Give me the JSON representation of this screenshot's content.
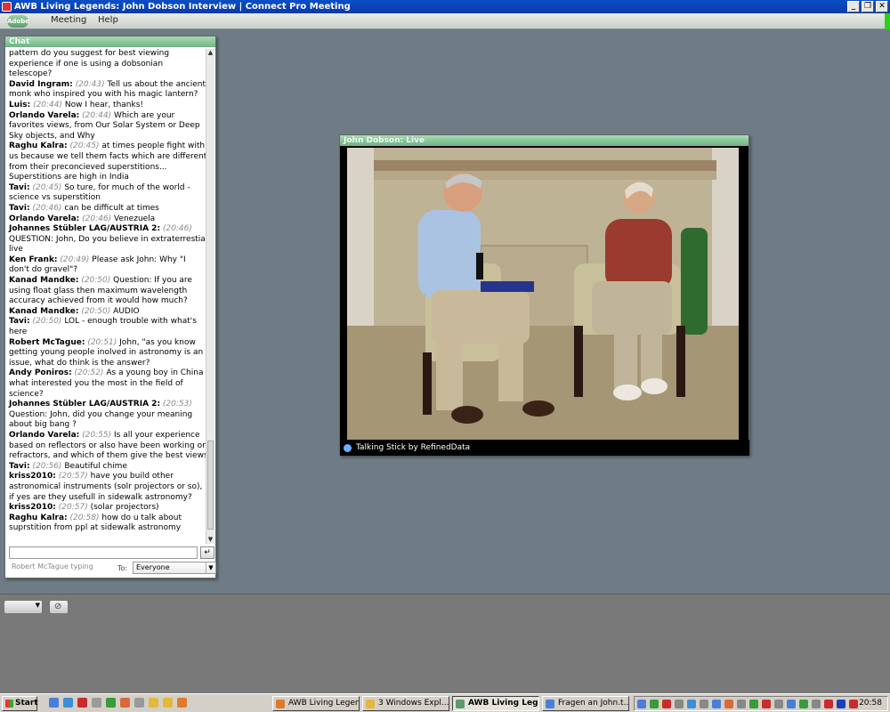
{
  "window": {
    "title": "AWB Living Legends: John Dobson Interview | Connect Pro Meeting",
    "min_glyph": "_",
    "max_glyph": "❐",
    "close_glyph": "✕"
  },
  "menubar": {
    "logo_text": "Adobe",
    "items": [
      "Meeting",
      "Help"
    ]
  },
  "chat": {
    "title": "Chat",
    "messages": [
      {
        "name": "",
        "time": "",
        "text": "pattern do you suggest for best viewing experience if one is using a dobsonian telescope?"
      },
      {
        "name": "David Ingram:",
        "time": "(20:43)",
        "text": "Tell us about the ancient monk who inspired you with his magic lantern?"
      },
      {
        "name": "Luis:",
        "time": "(20:44)",
        "text": "Now I hear, thanks!"
      },
      {
        "name": "Orlando Varela:",
        "time": "(20:44)",
        "text": "Which are your favorites views, from Our Solar System or Deep Sky objects, and Why"
      },
      {
        "name": "Raghu Kalra:",
        "time": "(20:45)",
        "text": "at times people fight with us because we tell them facts which are different from their preconcieved superstitions... Superstitions are high in India"
      },
      {
        "name": "Tavi:",
        "time": "(20:45)",
        "text": "So ture, for much of the world - science vs superstition"
      },
      {
        "name": "Tavi:",
        "time": "(20:46)",
        "text": "can be difficult at times"
      },
      {
        "name": "Orlando Varela:",
        "time": "(20:46)",
        "text": "Venezuela"
      },
      {
        "name": "Johannes Stübler LAG/AUSTRIA 2:",
        "time": "(20:46)",
        "text": "QUESTION: John, Do you believe in extraterrestial live"
      },
      {
        "name": "Ken Frank:",
        "time": "(20:49)",
        "text": "Please ask John: Why \"I don't do gravel\"?"
      },
      {
        "name": "Kanad Mandke:",
        "time": "(20:50)",
        "text": "Question: If you are using float glass then maximum wavelength accuracy achieved from it would how much?"
      },
      {
        "name": "Kanad Mandke:",
        "time": "(20:50)",
        "text": "AUDIO"
      },
      {
        "name": "Tavi:",
        "time": "(20:50)",
        "text": "LOL - enough trouble with what's here"
      },
      {
        "name": "Robert McTague:",
        "time": "(20:51)",
        "text": "John, \"as you know getting young people inolved in astronomy is an issue,  what do think is the answer?"
      },
      {
        "name": "Andy Poniros:",
        "time": "(20:52)",
        "text": "As a young boy in China what interested you the most in the field of science?"
      },
      {
        "name": "Johannes Stübler LAG/AUSTRIA 2:",
        "time": "(20:53)",
        "text": "Question: John, did you change your meaning about big bang ?"
      },
      {
        "name": "Orlando Varela:",
        "time": "(20:55)",
        "text": "Is all your experience based on reflectors or  also have been working on refractors, and which of them give the best views"
      },
      {
        "name": "Tavi:",
        "time": "(20:56)",
        "text": "Beautiful chime"
      },
      {
        "name": "kriss2010:",
        "time": "(20:57)",
        "text": "have you build other astronomical instruments (solr projectors or so), if yes are they usefull in sidewalk astronomy?"
      },
      {
        "name": "kriss2010:",
        "time": "(20:57)",
        "text": "(solar projectors)"
      },
      {
        "name": "Raghu Kalra:",
        "time": "(20:58)",
        "text": "how do u talk about suprstition from ppl at sidewalk astronomy"
      }
    ],
    "input_value": "",
    "send_glyph": "↵",
    "typing_status": "Robert McTague typing",
    "to_label": "To:",
    "to_value": "Everyone",
    "dropdown_glyph": "▼"
  },
  "video_pod": {
    "title": "John Dobson: Live",
    "footer_text": "Talking Stick by RefinedData"
  },
  "status_dropdown_glyph": "▼",
  "taskbar": {
    "start_label": "Start",
    "tasks": [
      {
        "label": "AWB Living Legen...",
        "active": false
      },
      {
        "label": "3 Windows Expl...",
        "active": false
      },
      {
        "label": "AWB Living Leg...",
        "active": true
      },
      {
        "label": "Fragen an John.t...",
        "active": false
      }
    ],
    "clock": "20:58"
  },
  "colors": {
    "pod_header": "#7fc293",
    "workspace": "#6f7c85",
    "titlebar": "#0a4fc6"
  }
}
